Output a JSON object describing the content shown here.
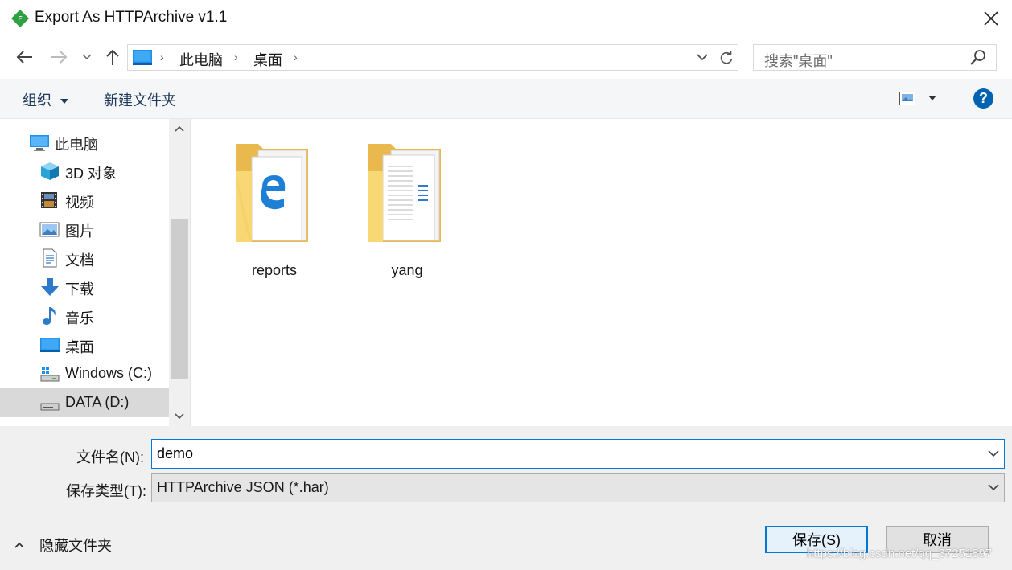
{
  "window": {
    "title": "Export As HTTPArchive v1.1",
    "close_symbol": "✕",
    "app_icon_letter": "F"
  },
  "nav": {
    "breadcrumb": [
      "此电脑",
      "桌面"
    ],
    "search_placeholder": "搜索\"桌面\""
  },
  "toolbar": {
    "organize_label": "组织",
    "new_folder_label": "新建文件夹",
    "help_symbol": "?"
  },
  "sidebar": {
    "items": [
      {
        "label": "此电脑",
        "icon": "computer-icon"
      },
      {
        "label": "3D 对象",
        "icon": "3d-objects-icon"
      },
      {
        "label": "视频",
        "icon": "video-icon"
      },
      {
        "label": "图片",
        "icon": "pictures-icon"
      },
      {
        "label": "文档",
        "icon": "documents-icon"
      },
      {
        "label": "下载",
        "icon": "download-icon"
      },
      {
        "label": "音乐",
        "icon": "music-icon"
      },
      {
        "label": "桌面",
        "icon": "desktop-icon"
      },
      {
        "label": "Windows (C:)",
        "icon": "windows-drive-icon"
      },
      {
        "label": "DATA (D:)",
        "icon": "drive-icon"
      }
    ],
    "selected_index": 9
  },
  "content": {
    "folders": [
      {
        "name": "reports",
        "icon": "folder-edge-icon"
      },
      {
        "name": "yang",
        "icon": "folder-docs-icon"
      }
    ]
  },
  "form": {
    "filename_label": "文件名(N):",
    "filename_value": "demo",
    "filetype_label": "保存类型(T):",
    "filetype_value": "HTTPArchive JSON (*.har)",
    "hide_folders_label": "隐藏文件夹",
    "save_label": "保存(S)",
    "cancel_label": "取消"
  },
  "watermark": "https://blog.csdn.net/qq_37251897",
  "colors": {
    "accent": "#0078d7",
    "toolbar_bg": "#f5f6f7",
    "bottom_bg": "#f0f0f0",
    "folder_yellow": "#f8d775"
  }
}
